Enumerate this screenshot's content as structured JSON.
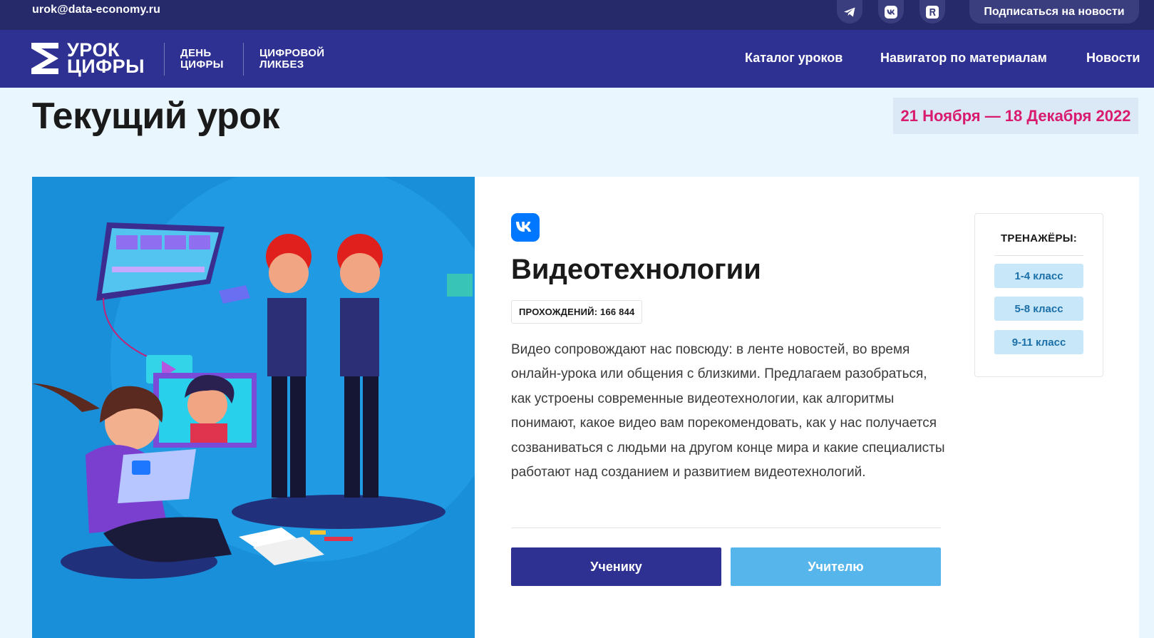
{
  "topbar": {
    "email": "urok@data-economy.ru",
    "social_icons": [
      "telegram-icon",
      "vk-icon",
      "rutube-icon"
    ],
    "subscribe_label": "Подписаться на новости"
  },
  "nav": {
    "logo_line1": "УРОК",
    "logo_line2": "ЦИФРЫ",
    "sub1_line1": "ДЕНЬ",
    "sub1_line2": "ЦИФРЫ",
    "sub2_line1": "ЦИФРОВОЙ",
    "sub2_line2": "ЛИКБЕЗ",
    "menu": [
      "Каталог уроков",
      "Навигатор по материалам",
      "Новости"
    ]
  },
  "page": {
    "title": "Текущий урок",
    "dates": "21 Ноября — 18 Декабря 2022"
  },
  "lesson": {
    "partner_icon": "vk-icon",
    "title": "Видеотехнологии",
    "passes": "ПРОХОЖДЕНИЙ: 166 844",
    "description": "Видео сопровождают нас повсюду: в ленте новостей, во время онлайн-урока или общения с близкими. Предлагаем разобраться, как устроены современные видеотехнологии, как алгоритмы понимают, какое видео вам порекомендовать, как у нас получается созваниваться с людьми на другом конце мира и какие специалисты работают над созданием и развитием видеотехнологий.",
    "student_button": "Ученику",
    "teacher_button": "Учителю"
  },
  "trainers": {
    "title": "ТРЕНАЖЁРЫ:",
    "grades": [
      "1-4 класс",
      "5-8 класс",
      "9-11 класс"
    ]
  },
  "colors": {
    "topbar": "#262a6b",
    "nav": "#2e3192",
    "accent_pink": "#d81b6e",
    "student_button": "#2e3192",
    "teacher_button": "#56b6ec",
    "illustration_bg": "#1a8fd9"
  }
}
